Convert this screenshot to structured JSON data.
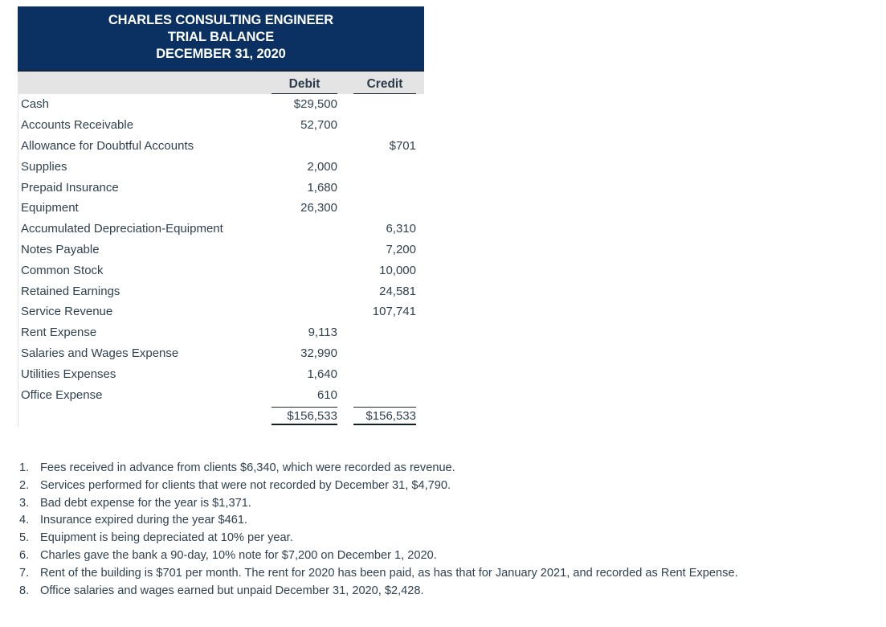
{
  "document": {
    "type": "accounting-worksheet",
    "accent_color": "#0a3161",
    "header_band_color": "#e4e4e4",
    "text_color": "#30414f"
  },
  "trial_balance": {
    "header": {
      "company": "CHARLES CONSULTING ENGINEER",
      "statement": "TRIAL BALANCE",
      "date": "DECEMBER 31, 2020"
    },
    "columns": {
      "account": "",
      "debit": "Debit",
      "credit": "Credit"
    },
    "rows": [
      {
        "account": "Cash",
        "debit": "$29,500",
        "credit": ""
      },
      {
        "account": "Accounts Receivable",
        "debit": "52,700",
        "credit": ""
      },
      {
        "account": "Allowance for Doubtful Accounts",
        "debit": "",
        "credit": "$701"
      },
      {
        "account": "Supplies",
        "debit": "2,000",
        "credit": ""
      },
      {
        "account": "Prepaid Insurance",
        "debit": "1,680",
        "credit": ""
      },
      {
        "account": "Equipment",
        "debit": "26,300",
        "credit": ""
      },
      {
        "account": "Accumulated Depreciation-Equipment",
        "debit": "",
        "credit": "6,310"
      },
      {
        "account": "Notes Payable",
        "debit": "",
        "credit": "7,200"
      },
      {
        "account": "Common Stock",
        "debit": "",
        "credit": "10,000"
      },
      {
        "account": "Retained Earnings",
        "debit": "",
        "credit": "24,581"
      },
      {
        "account": "Service Revenue",
        "debit": "",
        "credit": "107,741"
      },
      {
        "account": "Rent Expense",
        "debit": "9,113",
        "credit": ""
      },
      {
        "account": "Salaries and Wages Expense",
        "debit": "32,990",
        "credit": ""
      },
      {
        "account": "Utilities Expenses",
        "debit": "1,640",
        "credit": ""
      },
      {
        "account": "Office Expense",
        "debit": "610",
        "credit": ""
      }
    ],
    "totals": {
      "debit": "$156,533",
      "credit": "$156,533"
    }
  },
  "adjustments": {
    "items": [
      {
        "number": "1.",
        "text": "Fees received in advance from clients $6,340, which were recorded as revenue."
      },
      {
        "number": "2.",
        "text": "Services performed for clients that were not recorded by December 31, $4,790."
      },
      {
        "number": "3.",
        "text": "Bad debt expense for the year is $1,371."
      },
      {
        "number": "4.",
        "text": "Insurance expired during the year $461."
      },
      {
        "number": "5.",
        "text": "Equipment is being depreciated at 10% per year."
      },
      {
        "number": "6.",
        "text": "Charles gave the bank a 90-day, 10% note for $7,200 on December 1, 2020."
      },
      {
        "number": "7.",
        "text": "Rent of the building is $701 per month. The rent for 2020 has been paid, as has that for January 2021, and recorded as Rent Expense."
      },
      {
        "number": "8.",
        "text": "Office salaries and wages earned but unpaid December 31, 2020, $2,428."
      }
    ]
  }
}
